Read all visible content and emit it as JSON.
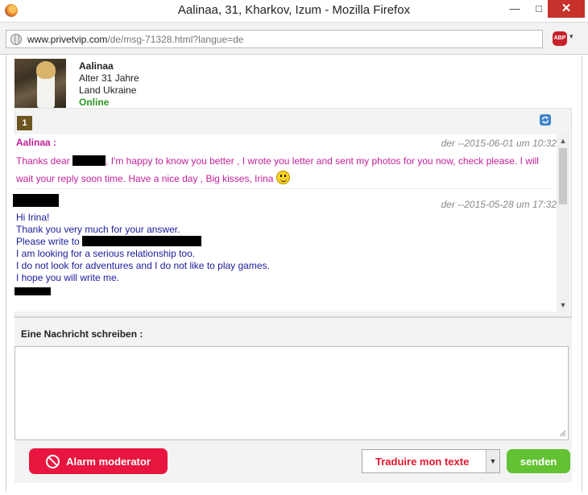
{
  "window": {
    "title": "Aalinaa, 31, Kharkov, Izum - Mozilla Firefox",
    "minimize_glyph": "—",
    "maximize_glyph": "□",
    "close_glyph": "✕"
  },
  "browser": {
    "url_host": "www.privetvip.com",
    "url_path": "/de/msg-71328.html?langue=de",
    "addon_label": "ABP",
    "addon_caret": "▾"
  },
  "profile": {
    "name": "Aalinaa",
    "age": "Alter 31 Jahre",
    "country": "Land Ukraine",
    "status": "Online",
    "status_color": "#2b9a22"
  },
  "conversation": {
    "page_number": "1",
    "messages": [
      {
        "sender": "Aalinaa :",
        "date": "der --2015-06-01 um 10:32",
        "text_before": "Thanks dear ",
        "text_after": ", I'm happy to know you better , I wrote you letter and sent my photos for you now, check please. I will wait your reply soon time. Have a nice day , Big kisses, Irina ",
        "color": "#c4209a"
      },
      {
        "date": "der --2015-05-28 um 17:32",
        "lines": [
          "Hi Irina!",
          "Thank you very much for your answer.",
          "Please write to ",
          "I am looking for a serious relationship too.",
          "I do not look for adventures and I do not like to play games.",
          "I hope you will write me."
        ],
        "color": "#1a1a9e"
      }
    ],
    "scroll_up": "▲",
    "scroll_down": "▼"
  },
  "compose": {
    "label": "Eine Nachricht schreiben :",
    "value": "",
    "alarm_label": "Alarm moderator",
    "translate_label": "Traduire mon texte",
    "translate_caret": "▼",
    "send_label": "senden"
  },
  "colors": {
    "alarm": "#e8163f",
    "send": "#63c234",
    "translate_text": "#e3162f",
    "badge": "#6d5420"
  },
  "icons": [
    "firefox-logo-icon",
    "globe-icon",
    "adblock-icon",
    "refresh-icon",
    "smiley-icon",
    "no-entry-icon",
    "resize-grip-icon"
  ]
}
